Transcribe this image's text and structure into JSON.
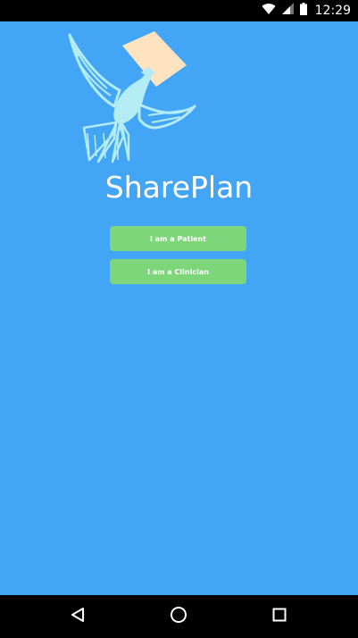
{
  "status_bar": {
    "time": "12:29",
    "icons": [
      "wifi-icon",
      "cell-signal-icon",
      "battery-icon"
    ]
  },
  "app": {
    "title": "SharePlan",
    "logo": "dove-with-letter-logo"
  },
  "buttons": {
    "patient_label": "I am a Patient",
    "clinician_label": "I am a Clinician"
  },
  "nav_bar": {
    "icons": [
      "back-icon",
      "home-icon",
      "recents-icon"
    ]
  },
  "colors": {
    "background": "#42a5f5",
    "button": "#7dd67a",
    "dove": "#b3ecf5",
    "letter": "#fde3c0"
  }
}
